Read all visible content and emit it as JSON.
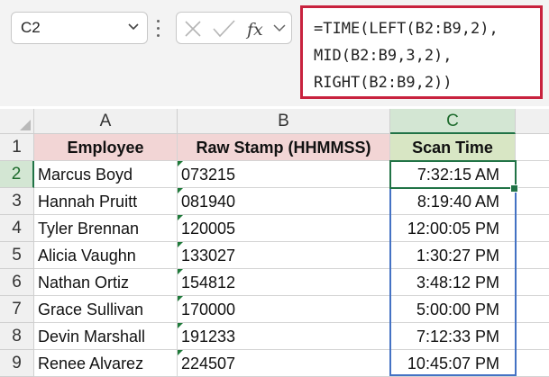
{
  "name_box": {
    "value": "C2"
  },
  "formula_bar": {
    "lines": [
      "=TIME(LEFT(B2:B9,2),",
      "MID(B2:B9,3,2),",
      "RIGHT(B2:B9,2))"
    ]
  },
  "columns": [
    "A",
    "B",
    "C"
  ],
  "selected_column": "C",
  "selected_row": "2",
  "header_row": {
    "row_number": "1",
    "cells": [
      "Employee",
      "Raw Stamp (HHMMSS)",
      "Scan Time"
    ]
  },
  "rows": [
    {
      "row_number": "2",
      "employee": "Marcus Boyd",
      "raw_stamp": "073215",
      "scan_time": "7:32:15 AM"
    },
    {
      "row_number": "3",
      "employee": "Hannah Pruitt",
      "raw_stamp": "081940",
      "scan_time": "8:19:40 AM"
    },
    {
      "row_number": "4",
      "employee": "Tyler Brennan",
      "raw_stamp": "120005",
      "scan_time": "12:00:05 PM"
    },
    {
      "row_number": "5",
      "employee": "Alicia Vaughn",
      "raw_stamp": "133027",
      "scan_time": "1:30:27 PM"
    },
    {
      "row_number": "6",
      "employee": "Nathan Ortiz",
      "raw_stamp": "154812",
      "scan_time": "3:48:12 PM"
    },
    {
      "row_number": "7",
      "employee": "Grace Sullivan",
      "raw_stamp": "170000",
      "scan_time": "5:00:00 PM"
    },
    {
      "row_number": "8",
      "employee": "Devin Marshall",
      "raw_stamp": "191233",
      "scan_time": "7:12:33 PM"
    },
    {
      "row_number": "9",
      "employee": "Renee Alvarez",
      "raw_stamp": "224507",
      "scan_time": "10:45:07 PM"
    }
  ],
  "icons": {
    "name_box_dropdown": "chevron-down-icon",
    "more_options": "vertical-dots-icon",
    "cancel": "cancel-x-icon",
    "enter": "checkmark-icon",
    "insert_function": "fx-icon",
    "formula_expand": "chevron-down-icon",
    "select_all": "select-all-corner-icon",
    "error_indicator": "green-triangle-icon"
  },
  "colors": {
    "formula_highlight": "#c8223e",
    "header_fill_pink": "#f2d5d5",
    "header_fill_green": "#d8e6c4",
    "selection_green": "#217346",
    "spill_range_blue": "#4472c4"
  }
}
